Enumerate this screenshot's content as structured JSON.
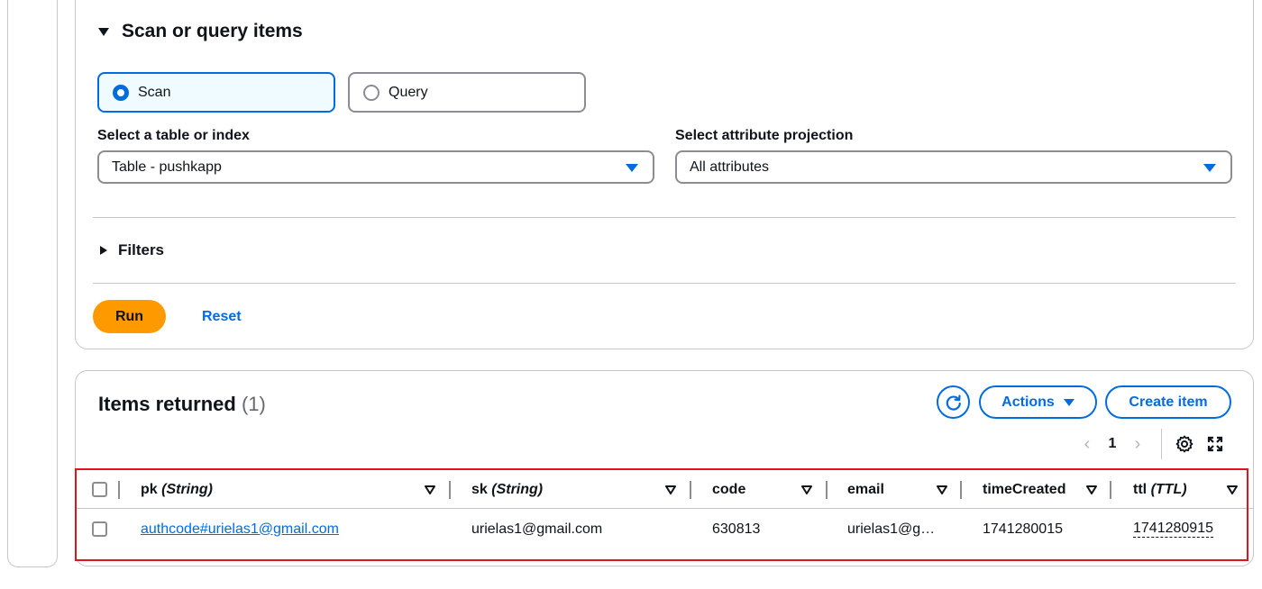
{
  "scan_panel": {
    "title": "Scan or query items",
    "mode_scan_label": "Scan",
    "mode_query_label": "Query",
    "selected_mode": "Scan",
    "table_select_label": "Select a table or index",
    "table_select_value": "Table - pushkapp",
    "projection_label": "Select attribute projection",
    "projection_value": "All attributes",
    "filters_label": "Filters",
    "run_label": "Run",
    "reset_label": "Reset"
  },
  "items_panel": {
    "title": "Items returned",
    "count": "(1)",
    "actions_label": "Actions",
    "create_label": "Create item",
    "page": "1"
  },
  "table": {
    "columns": [
      {
        "name": "pk",
        "type": "(String)"
      },
      {
        "name": "sk",
        "type": "(String)"
      },
      {
        "name": "code",
        "type": ""
      },
      {
        "name": "email",
        "type": ""
      },
      {
        "name": "timeCreated",
        "type": ""
      },
      {
        "name": "ttl",
        "type": "(TTL)"
      }
    ],
    "rows": [
      {
        "pk": "authcode#urielas1@gmail.com",
        "sk": "urielas1@gmail.com",
        "code": "630813",
        "email": "urielas1@g…",
        "timeCreated": "1741280015",
        "ttl": "1741280915"
      }
    ]
  },
  "colors": {
    "accent": "#006ce0",
    "run_button": "#ff9900",
    "highlight": "#e0141d"
  }
}
